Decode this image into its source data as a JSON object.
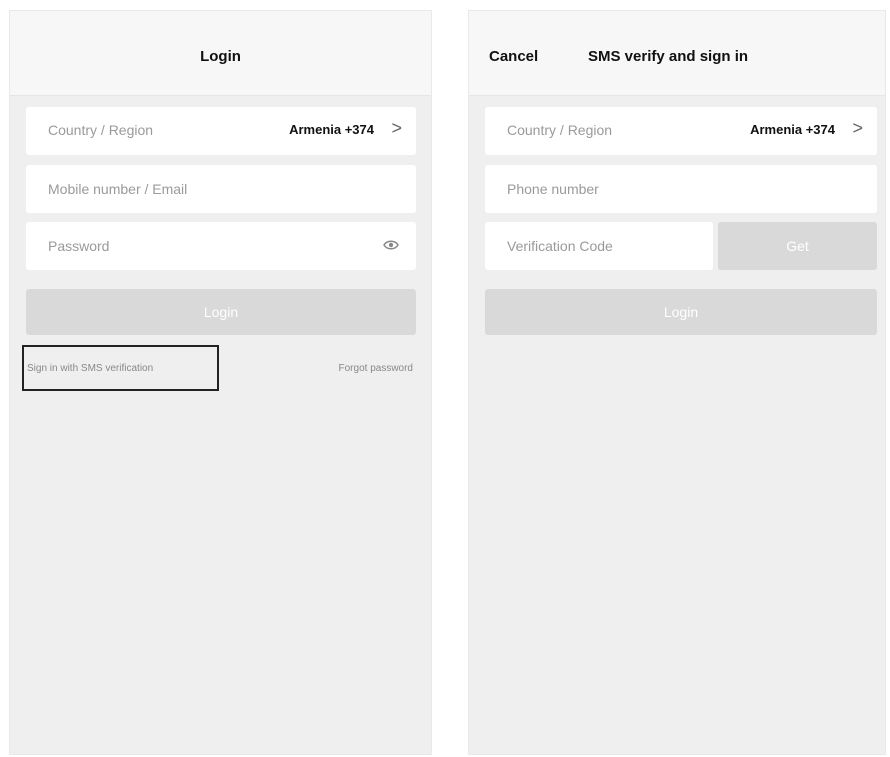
{
  "login": {
    "title": "Login",
    "country_label": "Country / Region",
    "country_value": "Armenia +374",
    "chevron": ">",
    "mobile_placeholder": "Mobile number / Email",
    "password_placeholder": "Password",
    "login_button": "Login",
    "sms_link": "Sign in with SMS verification",
    "forgot_link": "Forgot password"
  },
  "sms": {
    "cancel": "Cancel",
    "title": "SMS verify and sign in",
    "country_label": "Country / Region",
    "country_value": "Armenia +374",
    "chevron": ">",
    "phone_placeholder": "Phone number",
    "code_placeholder": "Verification Code",
    "get_code_button": "Get",
    "login_button": "Login"
  },
  "colors": {
    "panel_bg": "#efefef",
    "disabled_button": "#d9d9d9",
    "highlight_border": "#222222"
  },
  "icons": [
    "eye-icon",
    "chevron-right-icon"
  ]
}
